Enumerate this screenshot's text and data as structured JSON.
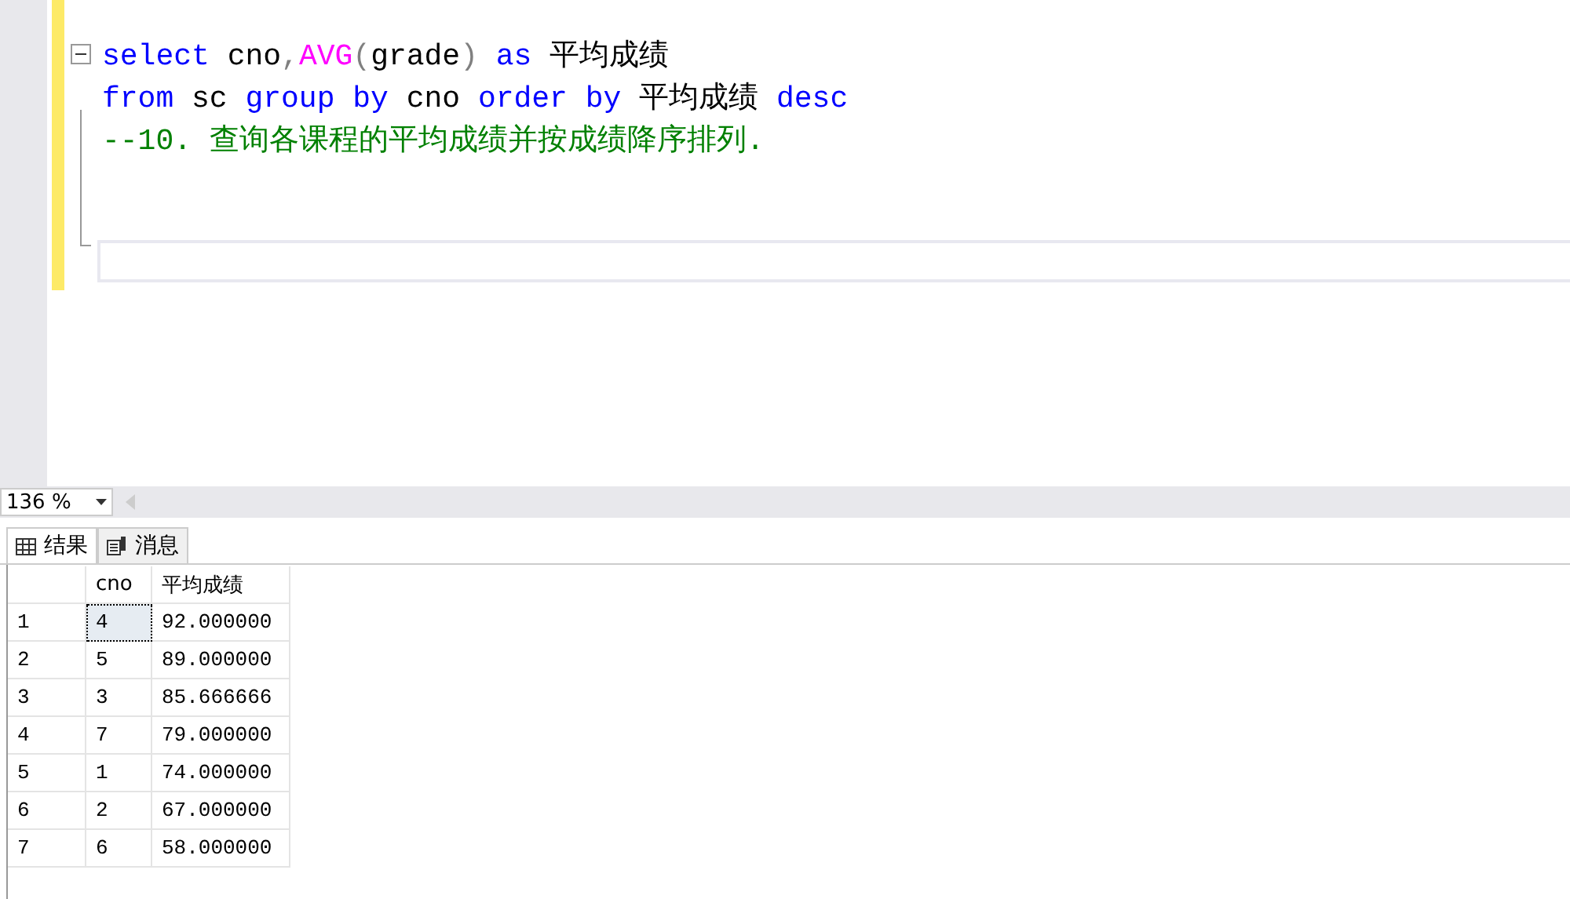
{
  "editor": {
    "lines": [
      {
        "foldable": true,
        "tokens": [
          {
            "text": "select",
            "kind": "keyword"
          },
          {
            "text": " cno",
            "kind": "plain"
          },
          {
            "text": ",",
            "kind": "punct"
          },
          {
            "text": "AVG",
            "kind": "function"
          },
          {
            "text": "(",
            "kind": "punct"
          },
          {
            "text": "grade",
            "kind": "plain"
          },
          {
            "text": ")",
            "kind": "punct"
          },
          {
            "text": " as",
            "kind": "keyword"
          },
          {
            "text": " 平均成绩",
            "kind": "plain"
          }
        ]
      },
      {
        "foldable": false,
        "tokens": [
          {
            "text": "from",
            "kind": "keyword"
          },
          {
            "text": " sc ",
            "kind": "plain"
          },
          {
            "text": "group by",
            "kind": "keyword"
          },
          {
            "text": " cno ",
            "kind": "plain"
          },
          {
            "text": "order by",
            "kind": "keyword"
          },
          {
            "text": " 平均成绩 ",
            "kind": "plain"
          },
          {
            "text": "desc",
            "kind": "keyword"
          }
        ]
      },
      {
        "foldable": false,
        "tokens": [
          {
            "text": "--10. 查询各课程的平均成绩并按成绩降序排列.",
            "kind": "comment"
          }
        ]
      }
    ]
  },
  "zoom": {
    "value": "136 %"
  },
  "result_tabs": [
    {
      "label": "结果",
      "kind": "results",
      "selected": true
    },
    {
      "label": "消息",
      "kind": "messages",
      "selected": false
    }
  ],
  "grid": {
    "columns": [
      "cno",
      "平均成绩"
    ],
    "rows": [
      {
        "number": "1",
        "cells": [
          "4",
          "92.000000"
        ],
        "focused": true
      },
      {
        "number": "2",
        "cells": [
          "5",
          "89.000000"
        ],
        "focused": false
      },
      {
        "number": "3",
        "cells": [
          "3",
          "85.666666"
        ],
        "focused": false
      },
      {
        "number": "4",
        "cells": [
          "7",
          "79.000000"
        ],
        "focused": false
      },
      {
        "number": "5",
        "cells": [
          "1",
          "74.000000"
        ],
        "focused": false
      },
      {
        "number": "6",
        "cells": [
          "2",
          "67.000000"
        ],
        "focused": false
      },
      {
        "number": "7",
        "cells": [
          "6",
          "58.000000"
        ],
        "focused": false
      }
    ]
  }
}
